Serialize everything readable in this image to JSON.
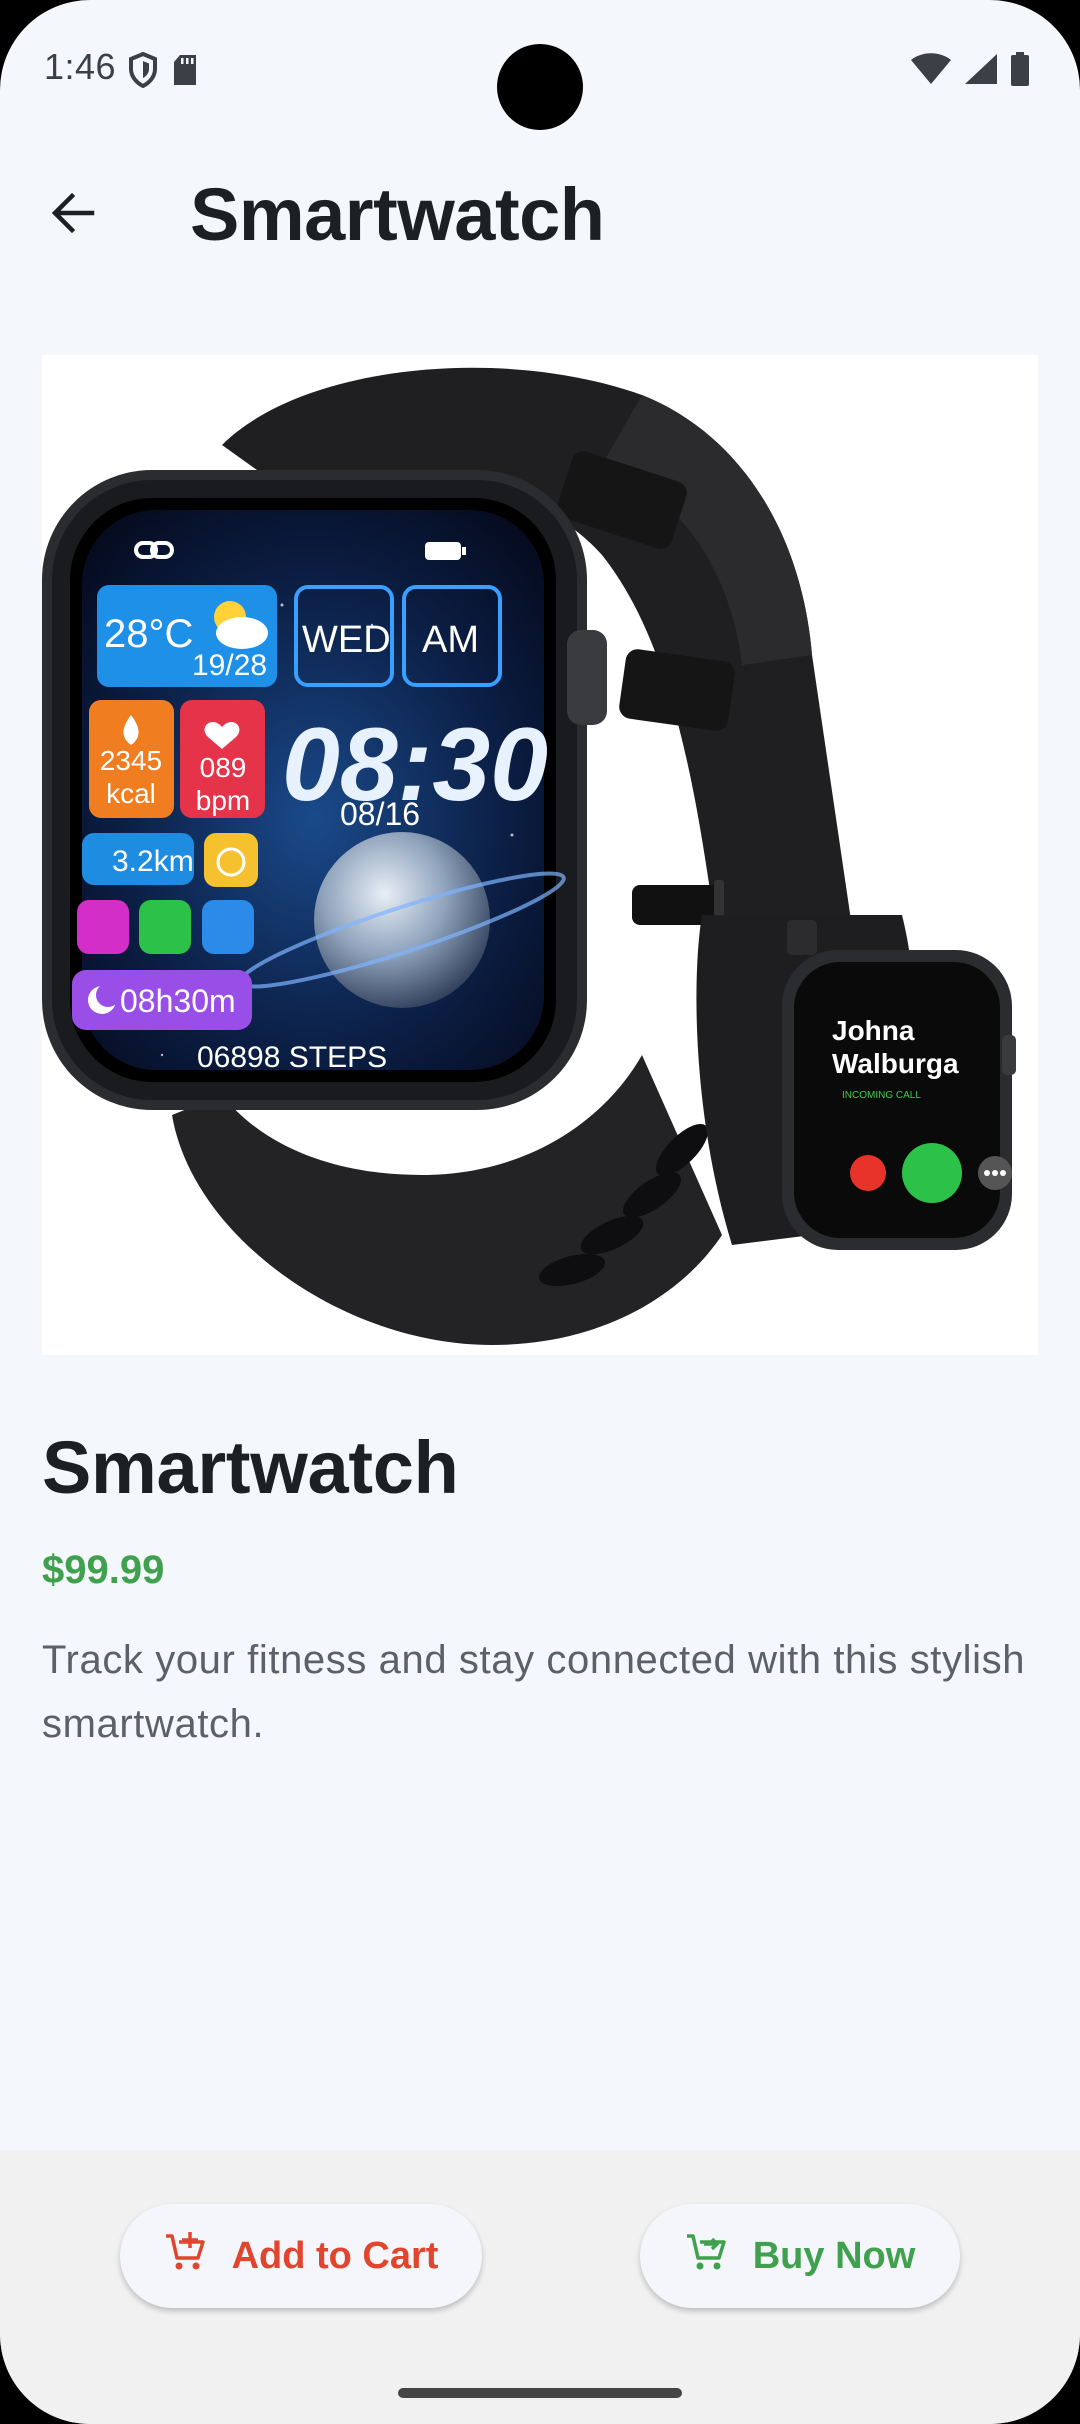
{
  "status_bar": {
    "time": "1:46",
    "left_icons": [
      "shield-icon",
      "sd-card-icon"
    ],
    "right_icons": [
      "wifi-icon",
      "cell-signal-icon",
      "battery-icon"
    ]
  },
  "app_bar": {
    "title": "Smartwatch",
    "back_icon": "arrow-back-icon"
  },
  "product": {
    "name": "Smartwatch",
    "price": "$99.99",
    "description": "Track your fitness and stay connected with this stylish smartwatch.",
    "image_text": {
      "temperature": "28°C",
      "temp_range": "19/28",
      "day": "WED",
      "meridiem": "AM",
      "time": "08:30",
      "date": "08/16",
      "calories_value": "2345",
      "calories_unit": "kcal",
      "heart_value": "089",
      "heart_unit": "bpm",
      "distance": "3.2km",
      "sleep": "08h30m",
      "steps": "06898 STEPS",
      "caller_first": "Johna",
      "caller_last": "Walburga",
      "call_status": "INCOMING CALL"
    }
  },
  "actions": {
    "add_to_cart": "Add to Cart",
    "buy_now": "Buy Now"
  },
  "colors": {
    "background": "#f4f7fc",
    "price": "#3fa14d",
    "add_to_cart": "#e2452d",
    "buy_now": "#3fa14d"
  }
}
